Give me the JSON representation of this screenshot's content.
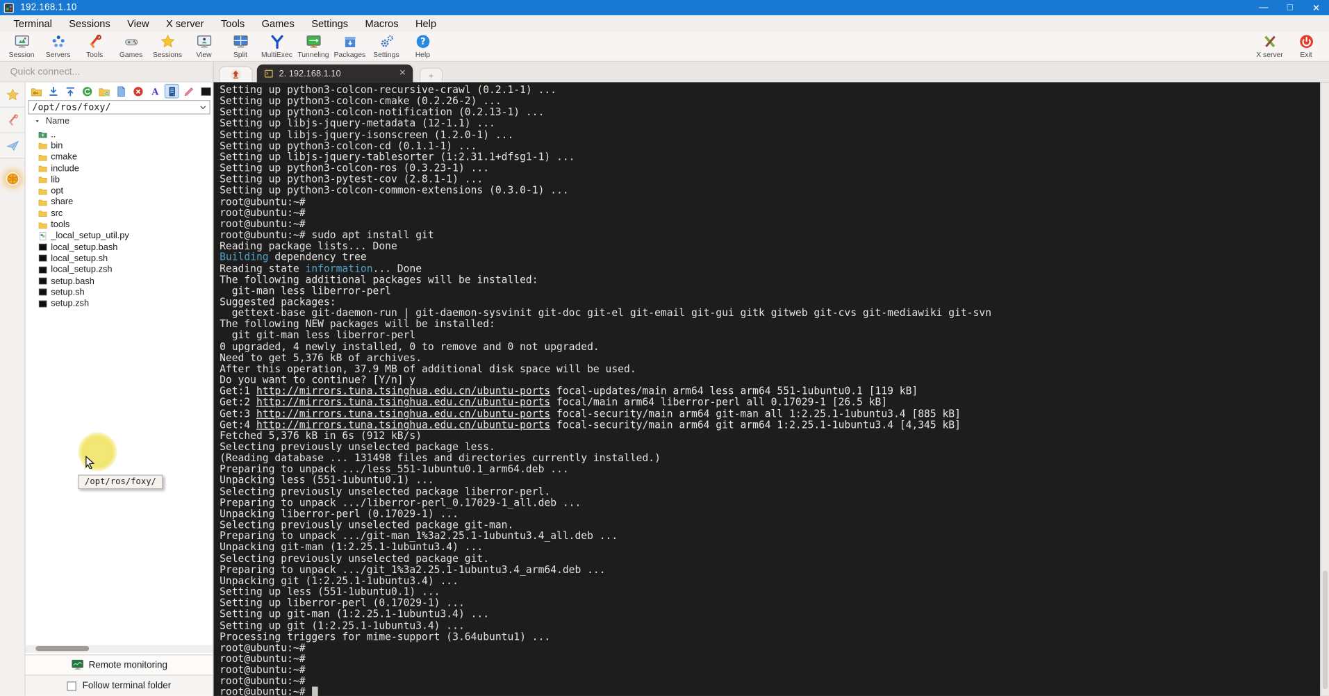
{
  "window": {
    "title": "192.168.1.10",
    "controls": {
      "minimize": "—",
      "maximize": "□",
      "close": "✕"
    }
  },
  "colors": {
    "titlebar_blue": "#1878d2",
    "terminal_bg": "#1e1d1d",
    "terminal_fg": "#e6e4e0",
    "keyword_cyan": "#4aa2c9",
    "active_tab_dark": "#2e2c2c",
    "folder_yellow": "#f4c54a"
  },
  "menu": {
    "items": [
      "Terminal",
      "Sessions",
      "View",
      "X server",
      "Tools",
      "Games",
      "Settings",
      "Macros",
      "Help"
    ]
  },
  "toolbar": {
    "items": [
      {
        "label": "Session",
        "icon": "session-icon"
      },
      {
        "label": "Servers",
        "icon": "servers-icon"
      },
      {
        "label": "Tools",
        "icon": "tools-icon"
      },
      {
        "label": "Games",
        "icon": "games-icon"
      },
      {
        "label": "Sessions",
        "icon": "sessions-star-icon"
      },
      {
        "label": "View",
        "icon": "view-icon"
      },
      {
        "label": "Split",
        "icon": "split-icon"
      },
      {
        "label": "MultiExec",
        "icon": "multiexec-icon"
      },
      {
        "label": "Tunneling",
        "icon": "tunneling-icon"
      },
      {
        "label": "Packages",
        "icon": "packages-icon"
      },
      {
        "label": "Settings",
        "icon": "settings-icon"
      },
      {
        "label": "Help",
        "icon": "help-icon"
      }
    ],
    "right_items": [
      {
        "label": "X server",
        "icon": "xserver-icon"
      },
      {
        "label": "Exit",
        "icon": "exit-icon"
      }
    ]
  },
  "sidebar": {
    "quick_connect_placeholder": "Quick connect...",
    "side_tabs": [
      {
        "name": "sessions-tab",
        "icon": "star-icon"
      },
      {
        "name": "tools-tab",
        "icon": "tools-pink-icon"
      },
      {
        "name": "sftp-tab",
        "icon": "paper-plane-icon"
      },
      {
        "name": "macros-tab",
        "icon": "macros-ball-icon",
        "style": "ball"
      }
    ],
    "file_toolbar": [
      {
        "icon": "qt-folder-icon"
      },
      {
        "icon": "qt-download-icon"
      },
      {
        "icon": "qt-upload-icon"
      },
      {
        "icon": "qt-refresh-icon"
      },
      {
        "icon": "qt-new-folder-icon"
      },
      {
        "icon": "qt-new-file-icon"
      },
      {
        "icon": "qt-delete-icon"
      },
      {
        "icon": "qt-rename-icon"
      },
      {
        "icon": "qt-tracking-icon",
        "selected": true
      },
      {
        "icon": "qt-edit-icon"
      },
      {
        "icon": "qt-terminal-icon"
      }
    ],
    "path": "/opt/ros/foxy/",
    "list_header": "Name",
    "files": [
      {
        "name": "..",
        "type": "up"
      },
      {
        "name": "bin",
        "type": "dir"
      },
      {
        "name": "cmake",
        "type": "dir"
      },
      {
        "name": "include",
        "type": "dir"
      },
      {
        "name": "lib",
        "type": "dir"
      },
      {
        "name": "opt",
        "type": "dir"
      },
      {
        "name": "share",
        "type": "dir"
      },
      {
        "name": "src",
        "type": "dir"
      },
      {
        "name": "tools",
        "type": "dir"
      },
      {
        "name": "_local_setup_util.py",
        "type": "py"
      },
      {
        "name": "local_setup.bash",
        "type": "sh"
      },
      {
        "name": "local_setup.sh",
        "type": "sh"
      },
      {
        "name": "local_setup.zsh",
        "type": "sh"
      },
      {
        "name": "setup.bash",
        "type": "sh"
      },
      {
        "name": "setup.sh",
        "type": "sh"
      },
      {
        "name": "setup.zsh",
        "type": "sh"
      }
    ],
    "tooltip": "/opt/ros/foxy/",
    "remote_monitoring_label": "Remote monitoring",
    "follow_terminal_label": "Follow terminal folder",
    "follow_checked": false
  },
  "tabs": {
    "active_label": "2. 192.168.1.10",
    "close_glyph": "✕"
  },
  "terminal": {
    "cursor": "block",
    "lines": [
      "Setting up python3-colcon-recursive-crawl (0.2.1-1) ...",
      "Setting up python3-colcon-cmake (0.2.26-2) ...",
      "Setting up python3-colcon-notification (0.2.13-1) ...",
      "Setting up libjs-jquery-metadata (12-1.1) ...",
      "Setting up libjs-jquery-isonscreen (1.2.0-1) ...",
      "Setting up python3-colcon-cd (0.1.1-1) ...",
      "Setting up libjs-jquery-tablesorter (1:2.31.1+dfsg1-1) ...",
      "Setting up python3-colcon-ros (0.3.23-1) ...",
      "Setting up python3-pytest-cov (2.8.1-1) ...",
      "Setting up python3-colcon-common-extensions (0.3.0-1) ...",
      "root@ubuntu:~#",
      "root@ubuntu:~#",
      "root@ubuntu:~#",
      "root@ubuntu:~# sudo apt install git",
      "Reading package lists... Done",
      [
        [
          "Building",
          "c"
        ],
        [
          " dependency tree",
          ""
        ]
      ],
      [
        [
          "Reading state ",
          ""
        ],
        [
          "information",
          "c"
        ],
        [
          "... Done",
          ""
        ]
      ],
      "The following additional packages will be installed:",
      "  git-man less liberror-perl",
      "Suggested packages:",
      "  gettext-base git-daemon-run | git-daemon-sysvinit git-doc git-el git-email git-gui gitk gitweb git-cvs git-mediawiki git-svn",
      "The following NEW packages will be installed:",
      "  git git-man less liberror-perl",
      "0 upgraded, 4 newly installed, 0 to remove and 0 not upgraded.",
      "Need to get 5,376 kB of archives.",
      "After this operation, 37.9 MB of additional disk space will be used.",
      "Do you want to continue? [Y/n] y",
      [
        [
          "Get:1 ",
          ""
        ],
        [
          "http://mirrors.tuna.tsinghua.edu.cn/ubuntu-ports",
          "u"
        ],
        [
          " focal-updates/main arm64 less arm64 551-1ubuntu0.1 [119 kB]",
          ""
        ]
      ],
      [
        [
          "Get:2 ",
          ""
        ],
        [
          "http://mirrors.tuna.tsinghua.edu.cn/ubuntu-ports",
          "u"
        ],
        [
          " focal/main arm64 liberror-perl all 0.17029-1 [26.5 kB]",
          ""
        ]
      ],
      [
        [
          "Get:3 ",
          ""
        ],
        [
          "http://mirrors.tuna.tsinghua.edu.cn/ubuntu-ports",
          "u"
        ],
        [
          " focal-security/main arm64 git-man all 1:2.25.1-1ubuntu3.4 [885 kB]",
          ""
        ]
      ],
      [
        [
          "Get:4 ",
          ""
        ],
        [
          "http://mirrors.tuna.tsinghua.edu.cn/ubuntu-ports",
          "u"
        ],
        [
          " focal-security/main arm64 git arm64 1:2.25.1-1ubuntu3.4 [4,345 kB]",
          ""
        ]
      ],
      "Fetched 5,376 kB in 6s (912 kB/s)",
      "Selecting previously unselected package less.",
      "(Reading database ... 131498 files and directories currently installed.)",
      "Preparing to unpack .../less_551-1ubuntu0.1_arm64.deb ...",
      "Unpacking less (551-1ubuntu0.1) ...",
      "Selecting previously unselected package liberror-perl.",
      "Preparing to unpack .../liberror-perl_0.17029-1_all.deb ...",
      "Unpacking liberror-perl (0.17029-1) ...",
      "Selecting previously unselected package git-man.",
      "Preparing to unpack .../git-man_1%3a2.25.1-1ubuntu3.4_all.deb ...",
      "Unpacking git-man (1:2.25.1-1ubuntu3.4) ...",
      "Selecting previously unselected package git.",
      "Preparing to unpack .../git_1%3a2.25.1-1ubuntu3.4_arm64.deb ...",
      "Unpacking git (1:2.25.1-1ubuntu3.4) ...",
      "Setting up less (551-1ubuntu0.1) ...",
      "Setting up liberror-perl (0.17029-1) ...",
      "Setting up git-man (1:2.25.1-1ubuntu3.4) ...",
      "Setting up git (1:2.25.1-1ubuntu3.4) ...",
      "Processing triggers for mime-support (3.64ubuntu1) ...",
      "root@ubuntu:~#",
      "root@ubuntu:~#",
      "root@ubuntu:~#",
      "root@ubuntu:~#",
      "root@ubuntu:~# "
    ]
  }
}
